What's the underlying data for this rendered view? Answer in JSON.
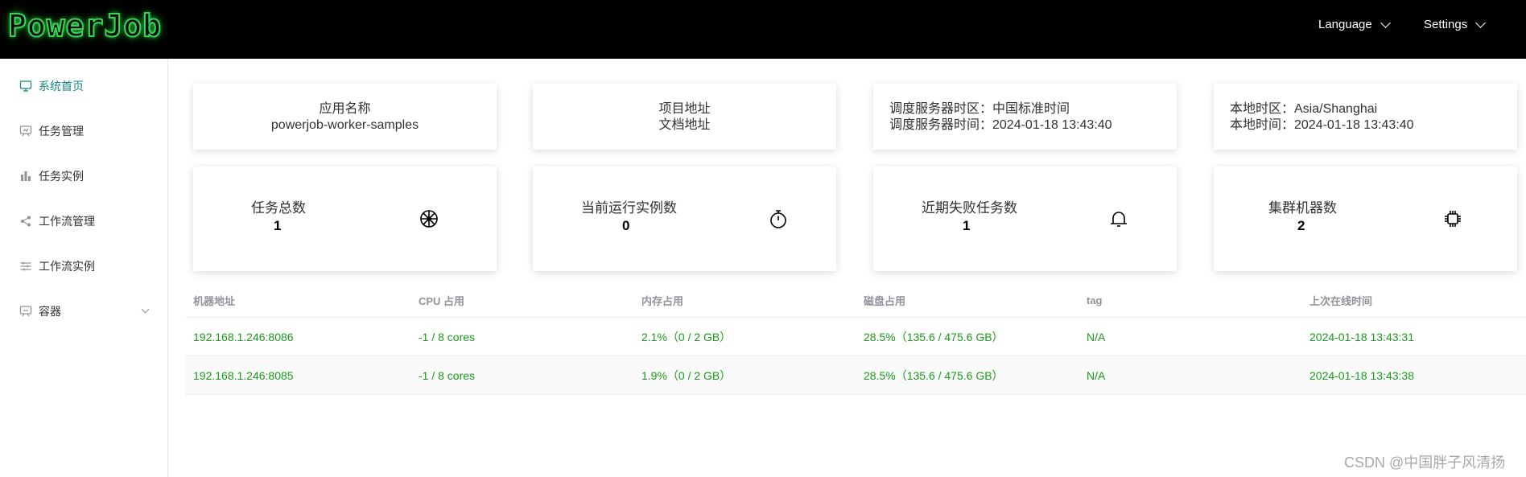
{
  "header": {
    "logo": "PowerJob",
    "language": "Language",
    "settings": "Settings"
  },
  "sidebar": {
    "items": [
      {
        "label": "系统首页",
        "icon": "monitor-icon"
      },
      {
        "label": "任务管理",
        "icon": "task-board-icon"
      },
      {
        "label": "任务实例",
        "icon": "bar-chart-icon"
      },
      {
        "label": "工作流管理",
        "icon": "share-icon"
      },
      {
        "label": "工作流实例",
        "icon": "sliders-icon"
      },
      {
        "label": "容器",
        "icon": "container-icon"
      }
    ]
  },
  "info_cards": {
    "app": {
      "label": "应用名称",
      "value": "powerjob-worker-samples"
    },
    "project": {
      "repo": "项目地址",
      "docs": "文档地址"
    },
    "server": {
      "timezone": "调度服务器时区：中国标准时间",
      "time": "调度服务器时间：2024-01-18 13:43:40"
    },
    "local": {
      "timezone": "本地时区：Asia/Shanghai",
      "time": "本地时间：2024-01-18 13:43:40"
    }
  },
  "stats": [
    {
      "title": "任务总数",
      "value": "1",
      "icon": "wheel-icon"
    },
    {
      "title": "当前运行实例数",
      "value": "0",
      "icon": "stopwatch-icon"
    },
    {
      "title": "近期失败任务数",
      "value": "1",
      "icon": "bell-icon"
    },
    {
      "title": "集群机器数",
      "value": "2",
      "icon": "cpu-icon"
    }
  ],
  "table": {
    "columns": [
      "机器地址",
      "CPU 占用",
      "内存占用",
      "磁盘占用",
      "tag",
      "上次在线时间"
    ],
    "rows": [
      [
        "192.168.1.246:8086",
        "-1 / 8 cores",
        "2.1%（0 / 2 GB）",
        "28.5%（135.6 / 475.6 GB）",
        "N/A",
        "2024-01-18 13:43:31"
      ],
      [
        "192.168.1.246:8085",
        "-1 / 8 cores",
        "1.9%（0 / 2 GB）",
        "28.5%（135.6 / 475.6 GB）",
        "N/A",
        "2024-01-18 13:43:38"
      ]
    ]
  },
  "watermark": "CSDN @中国胖子风清扬",
  "colors": {
    "header_bg": "#000000",
    "accent": "#128a87",
    "logo_glow": "#39d353",
    "table_text": "#1a9b1a"
  }
}
